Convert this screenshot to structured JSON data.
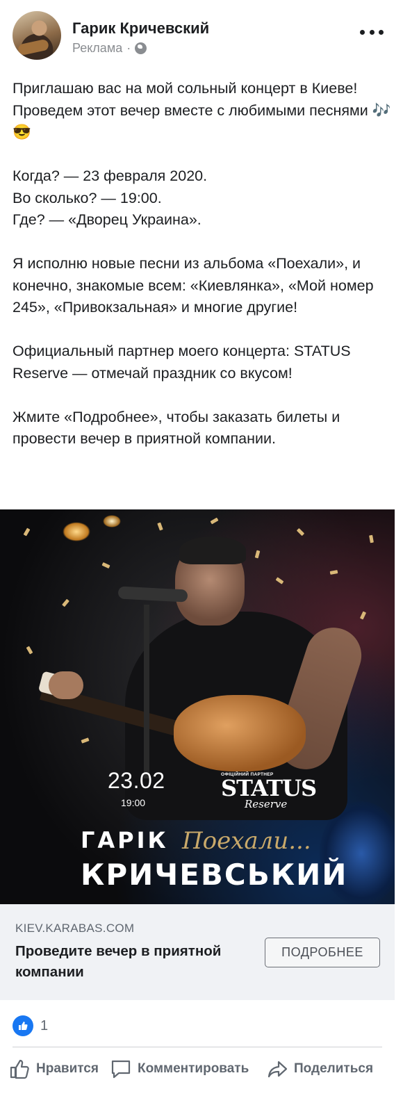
{
  "post": {
    "author": "Гарик Кричевский",
    "sponsored_label": "Реклама",
    "separator": "·",
    "paragraphs": [
      "Приглашаю вас на мой сольный концерт в Киеве! Проведем этот вечер вместе с любимыми песнями 🎶😎",
      "Когда? — 23 февраля 2020.\nВо сколько? — 19:00.\nГде? — «Дворец Украина».",
      "Я исполню новые песни из альбома «Поехали», и конечно, знакомые всем: «Киевлянка», «Мой номер 245», «Привокзальная» и многие другие!",
      "Официальный партнер моего концерта: STATUS Reserve — отмечай праздник со вкусом!",
      "Жмите «Подробнее», чтобы заказать билеты и провести вечер в приятной компании."
    ]
  },
  "image": {
    "date": "23.02",
    "time": "19:00",
    "partner_label": "ОФІЦІЙНИЙ ПАРТНЕР",
    "partner_logo": "STATUS",
    "partner_logo_sub": "Reserve",
    "artist_first": "ГАРІК",
    "album_name": "Поехали...",
    "artist_last": "КРИЧЕВСЬКИЙ"
  },
  "link_preview": {
    "domain": "KIEV.KARABAS.COM",
    "title": "Проведите вечер в приятной компании",
    "cta_label": "ПОДРОБНЕЕ"
  },
  "reactions": {
    "icon": "like-icon",
    "count": "1"
  },
  "actions": {
    "like_label": "Нравится",
    "comment_label": "Комментировать",
    "share_label": "Поделиться"
  },
  "colors": {
    "accent": "#1877f2",
    "secondary_text": "#606770",
    "link_box_bg": "#f0f2f5",
    "gold": "#c9a96a"
  }
}
